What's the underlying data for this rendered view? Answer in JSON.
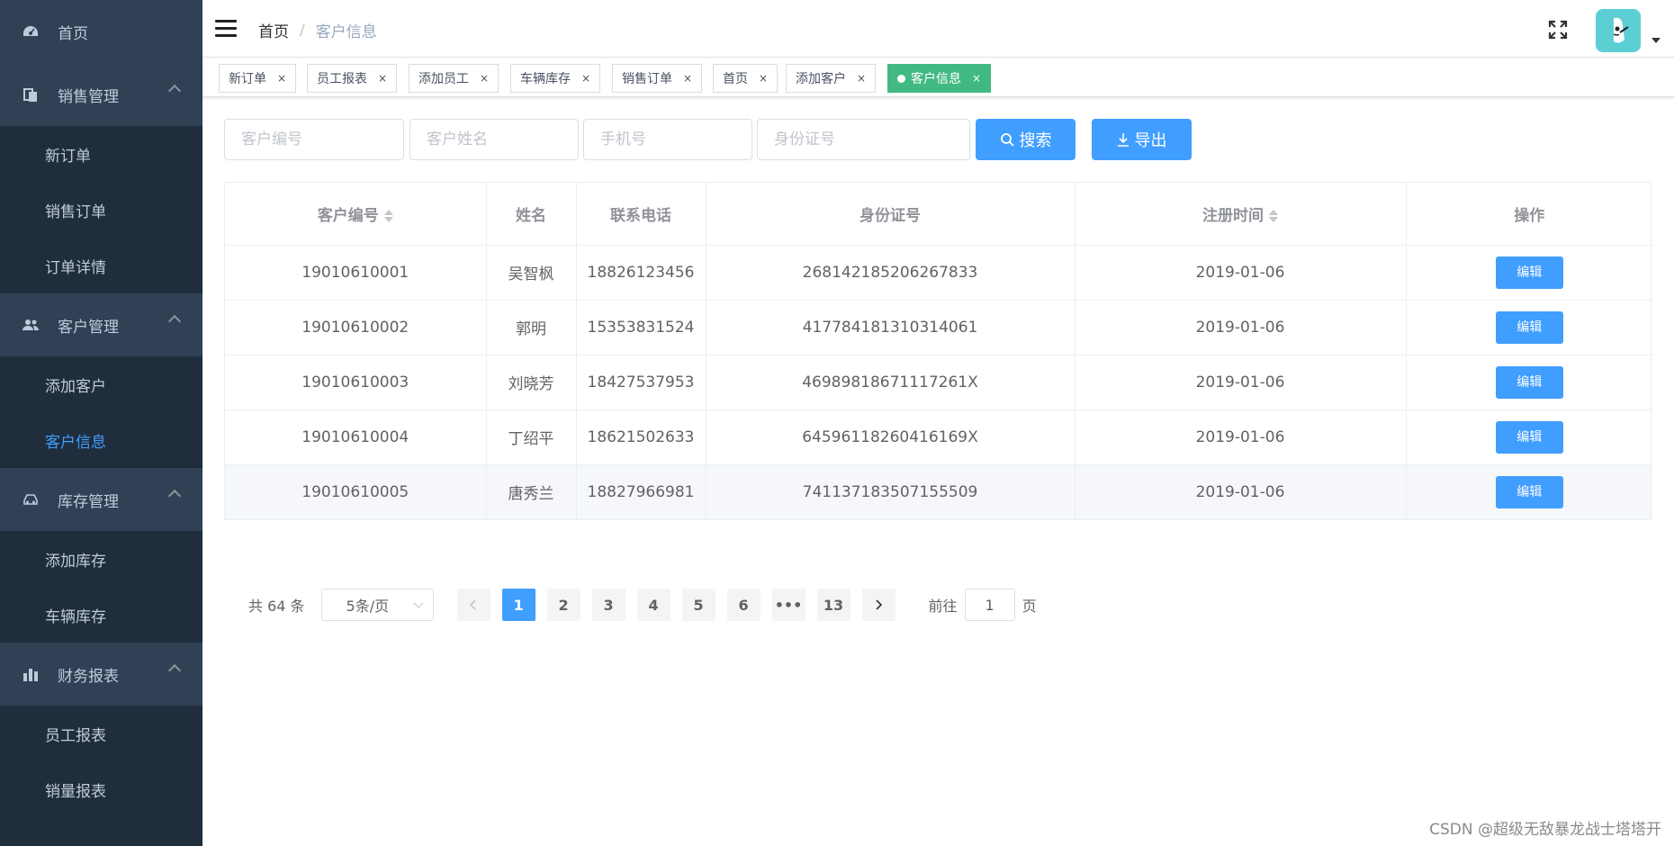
{
  "sidebar": {
    "home": {
      "label": "首页",
      "icon": "dashboard-icon"
    },
    "groups": [
      {
        "label": "销售管理",
        "icon": "document-icon",
        "items": [
          "新订单",
          "销售订单",
          "订单详情"
        ]
      },
      {
        "label": "客户管理",
        "icon": "users-icon",
        "items": [
          "添加客户",
          "客户信息"
        ]
      },
      {
        "label": "库存管理",
        "icon": "car-icon",
        "items": [
          "添加库存",
          "车辆库存"
        ]
      },
      {
        "label": "财务报表",
        "icon": "bar-chart-icon",
        "items": [
          "员工报表",
          "销量报表"
        ]
      }
    ],
    "active_item": "客户信息"
  },
  "navbar": {
    "breadcrumb": {
      "home": "首页",
      "separator": "/",
      "current": "客户信息"
    }
  },
  "tags": [
    "新订单",
    "员工报表",
    "添加员工",
    "车辆库存",
    "销售订单",
    "首页",
    "添加客户",
    "客户信息"
  ],
  "active_tag": "客户信息",
  "tag_close": "×",
  "filters": {
    "customer_id_placeholder": "客户编号",
    "customer_name_placeholder": "客户姓名",
    "phone_placeholder": "手机号",
    "id_card_placeholder": "身份证号",
    "search_label": "搜索",
    "export_label": "导出"
  },
  "table": {
    "headers": [
      "客户编号",
      "姓名",
      "联系电话",
      "身份证号",
      "注册时间",
      "操作"
    ],
    "rows": [
      {
        "id": "19010610001",
        "name": "吴智枫",
        "phone": "18826123456",
        "id_card": "268142185206267833",
        "date": "2019-01-06",
        "action": "编辑"
      },
      {
        "id": "19010610002",
        "name": "郭明",
        "phone": "15353831524",
        "id_card": "417784181310314061",
        "date": "2019-01-06",
        "action": "编辑"
      },
      {
        "id": "19010610003",
        "name": "刘晓芳",
        "phone": "18427537953",
        "id_card": "469898186711172 61X",
        "date": "2019-01-06",
        "action": "编辑"
      },
      {
        "id": "19010610004",
        "name": "丁绍平",
        "phone": "18621502633",
        "id_card": "64596118260416169X",
        "date": "2019-01-06",
        "action": "编辑"
      },
      {
        "id": "19010610005",
        "name": "唐秀兰",
        "phone": "18827966981",
        "id_card": "741137183507155509",
        "date": "2019-01-06",
        "action": "编辑"
      }
    ]
  },
  "pagination": {
    "total": "共 64 条",
    "page_size": "5条/页",
    "pages": [
      "1",
      "2",
      "3",
      "4",
      "5",
      "6",
      "•••",
      "13"
    ],
    "current_page": "1",
    "goto_prefix": "前往",
    "goto_value": "1",
    "goto_suffix": "页"
  },
  "watermark": "CSDN @超级无敌暴龙战士塔塔开",
  "colors": {
    "primary": "#409eff",
    "tag_active": "#42b983",
    "sidebar_bg": "#304156",
    "submenu_bg": "#1f2d3d"
  }
}
